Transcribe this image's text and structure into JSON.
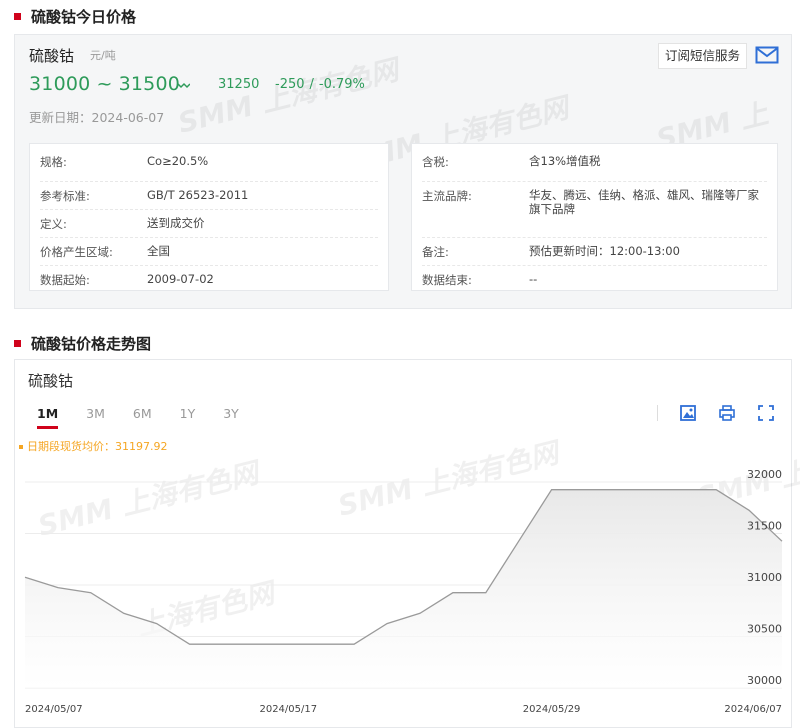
{
  "section1": {
    "title": "硫酸钴今日价格"
  },
  "price": {
    "product": "硫酸钴",
    "unit": "元/吨",
    "low": "31000",
    "separator": "~",
    "high": "31500",
    "average": "31250",
    "change": "-250",
    "change_pct": "-0.79%",
    "update_label": "更新日期：",
    "update_date": "2024-06-07",
    "subscribe_label": "订阅短信服务"
  },
  "info_left": [
    {
      "k": "规格:",
      "v": "Co≥20.5%"
    },
    {
      "k": "参考标准:",
      "v": "GB/T 26523-2011"
    },
    {
      "k": "定义:",
      "v": "送到成交价"
    },
    {
      "k": "价格产生区域:",
      "v": "全国"
    },
    {
      "k": "数据起始:",
      "v": "2009-07-02"
    }
  ],
  "info_right": [
    {
      "k": "含税:",
      "v": "含13%增值税"
    },
    {
      "k": "主流品牌:",
      "v": "华友、腾远、佳纳、格派、雄风、瑞隆等厂家旗下品牌"
    },
    {
      "k": "备注:",
      "v": "预估更新时间：12:00-13:00"
    },
    {
      "k": "数据结束:",
      "v": "--"
    }
  ],
  "section2": {
    "title": "硫酸钴价格走势图"
  },
  "chart": {
    "name": "硫酸钴",
    "tabs": [
      "1M",
      "3M",
      "6M",
      "1Y",
      "3Y"
    ],
    "active_tab": "1M",
    "avg_label": "日期段现货均价：31197.92",
    "icons": [
      "image-icon",
      "print-icon",
      "fullscreen-icon"
    ],
    "color_line": "#9a9a9a",
    "color_area": "#e8e8e8"
  },
  "watermark": "SMM 上海有色网",
  "chart_data": {
    "type": "area",
    "x": [
      "2024/05/07",
      "2024/05/08",
      "2024/05/09",
      "2024/05/10",
      "2024/05/13",
      "2024/05/14",
      "2024/05/15",
      "2024/05/16",
      "2024/05/17",
      "2024/05/20",
      "2024/05/21",
      "2024/05/22",
      "2024/05/23",
      "2024/05/24",
      "2024/05/27",
      "2024/05/28",
      "2024/05/29",
      "2024/05/30",
      "2024/05/31",
      "2024/06/03",
      "2024/06/04",
      "2024/06/05",
      "2024/06/06",
      "2024/06/07"
    ],
    "y": [
      31075,
      30975,
      30925,
      30725,
      30625,
      30425,
      30425,
      30425,
      30425,
      30425,
      30425,
      30625,
      30725,
      30925,
      30925,
      31425,
      31925,
      31925,
      31925,
      31925,
      31925,
      31925,
      31725,
      31425
    ],
    "xticks": [
      "2024/05/07",
      "2024/05/17",
      "2024/05/29",
      "2024/06/07"
    ],
    "yticks": [
      30000,
      30500,
      31000,
      31500,
      32000
    ],
    "ylim": [
      30000,
      32000
    ],
    "grid": true,
    "ylabel": "",
    "xlabel": ""
  }
}
